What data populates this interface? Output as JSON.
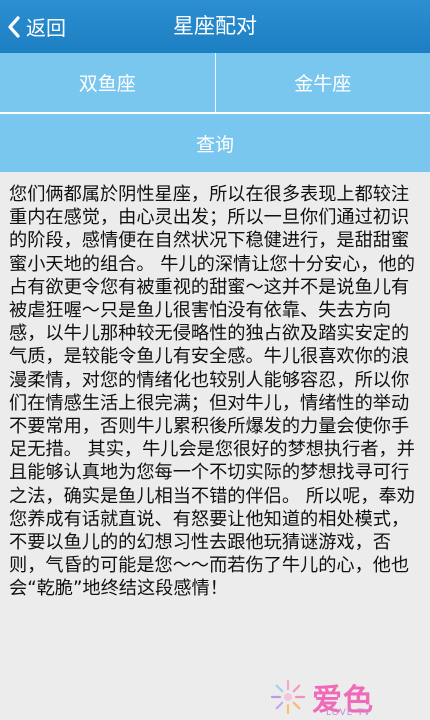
{
  "header": {
    "back_label": "返回",
    "title": "星座配对"
  },
  "selection": {
    "left_sign": "双鱼座",
    "right_sign": "金牛座",
    "query_label": "查询"
  },
  "result": {
    "text": "您们俩都属於阴性星座，所以在很多表现上都较注重内在感觉，由心灵出发；所以一旦你们通过初识的阶段，感情便在自然状况下稳健进行，是甜甜蜜蜜小天地的组合。 牛儿的深情让您十分安心，他的占有欲更令您有被重视的甜蜜～这并不是说鱼儿有被虐狂喔～只是鱼儿很害怕没有依靠、失去方向感，以牛儿那种较无侵略性的独占欲及踏实安定的气质，是较能令鱼儿有安全感。牛儿很喜欢你的浪漫柔情，对您的情绪化也较别人能够容忍，所以你们在情感生活上很完满；但对牛儿，情绪性的举动不要常用，否则牛儿累积後所爆发的力量会使你手足无措。 其实，牛儿会是您很好的梦想执行者，并且能够认真地为您每一个不切实际的梦想找寻可行之法，确实是鱼儿相当不错的伴侣。 所以呢，奉劝您养成有话就直说、有怒要让他知道的相处模式，不要以鱼儿的的幻想习性去跟他玩猜谜游戏，否则，气昏的可能是您～～而若伤了牛儿的心，他也会“乾脆”地终结这段感情！"
  },
  "watermark": {
    "brand": "爱色",
    "sub": "LOVE TV"
  },
  "colors": {
    "header_bg": "#1d7fc3",
    "panel_bg": "#79c6ee",
    "page_bg": "#ececec",
    "watermark": "#f06ab8"
  },
  "icons": {
    "back": "chevron-left-icon",
    "watermark_logo": "flower-logo-icon"
  }
}
